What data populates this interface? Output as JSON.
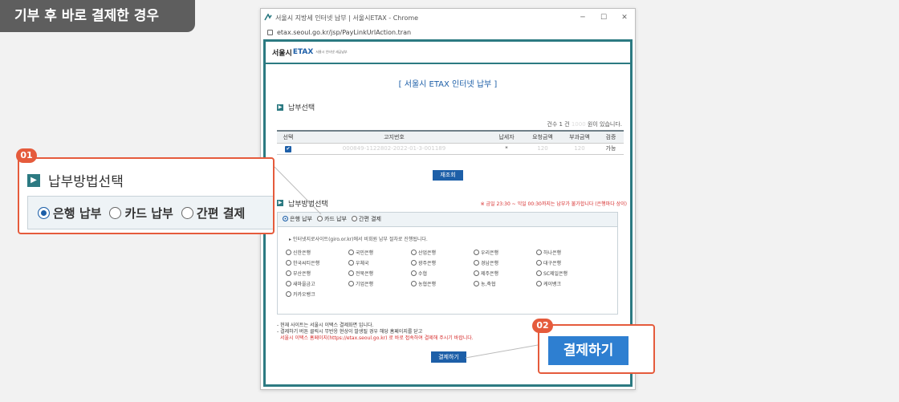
{
  "tag_label": "기부 후 바로 결제한 경우",
  "window": {
    "title": "서울시 지방세 인터넷 납부 | 서울시ETAX - Chrome",
    "url": "etax.seoul.go.kr/jsp/PayLinkUrlAction.tran",
    "controls": {
      "minimize": "─",
      "maximize": "☐",
      "close": "✕"
    }
  },
  "site": {
    "logo_seoul": "서울시",
    "logo_etax": "ETAX",
    "logo_sub": "서울시 인터넷 세금납부",
    "page_title": "[ 서울시 ETAX 인터넷 납부 ]"
  },
  "payment_select": {
    "heading": "납부선택",
    "count_prefix": "건수 1 건",
    "count_amount": "1000",
    "count_suffix": "원이 있습니다.",
    "columns": [
      "선택",
      "고지번호",
      "납세자",
      "요청금액",
      "부과금액",
      "검증"
    ],
    "rows": [
      {
        "checked": true,
        "notice_no": "000849-1122802-2022-01-3-001189",
        "payer": "*",
        "request_amt": "120",
        "levy_amt": "120",
        "verify": "가능"
      }
    ],
    "requery_button": "재조회"
  },
  "method_select": {
    "heading": "납부방법선택",
    "notice": "※ 금일 23:30 ~ 익일 00:30까지는 납부가 불가합니다 (은행마다 상이)",
    "options": [
      {
        "label": "은행 납부",
        "selected": true
      },
      {
        "label": "카드 납부",
        "selected": false
      },
      {
        "label": "간편 결제",
        "selected": false
      }
    ],
    "guide": "인터넷지로사이트(giro.or.kr)에서 비회원 납부 절차로 진행됩니다.",
    "banks": [
      "신한은행",
      "국민은행",
      "산업은행",
      "우리은행",
      "하나은행",
      "한국씨티은행",
      "우체국",
      "광주은행",
      "경남은행",
      "대구은행",
      "부산은행",
      "전북은행",
      "수협",
      "제주은행",
      "SC제일은행",
      "새마을금고",
      "기업은행",
      "농협은행",
      "농,축협",
      "케이뱅크",
      "카카오뱅크"
    ]
  },
  "footer": {
    "note1": "- 현재 사이트는 서울시 이택스 결제화면 입니다.",
    "note2": "- 결제하기 버튼 클릭시 무반응 현상이 발생될 경우 해당 홈페이지를 닫고",
    "note3": "서울시 이택스 홈페이지(https://etax.seoul.go.kr) 로 바로 접속하여 결제해 주시기 바랍니다.",
    "pay_button": "결제하기"
  },
  "callouts": {
    "c1": {
      "badge": "01",
      "heading": "납부방법선택",
      "options": [
        "은행 납부",
        "카드 납부",
        "간편 결제"
      ]
    },
    "c2": {
      "badge": "02",
      "button": "결제하기"
    }
  },
  "colors": {
    "accent": "#e55b3c",
    "teal": "#2c7a82",
    "blue": "#1d5fa8"
  }
}
